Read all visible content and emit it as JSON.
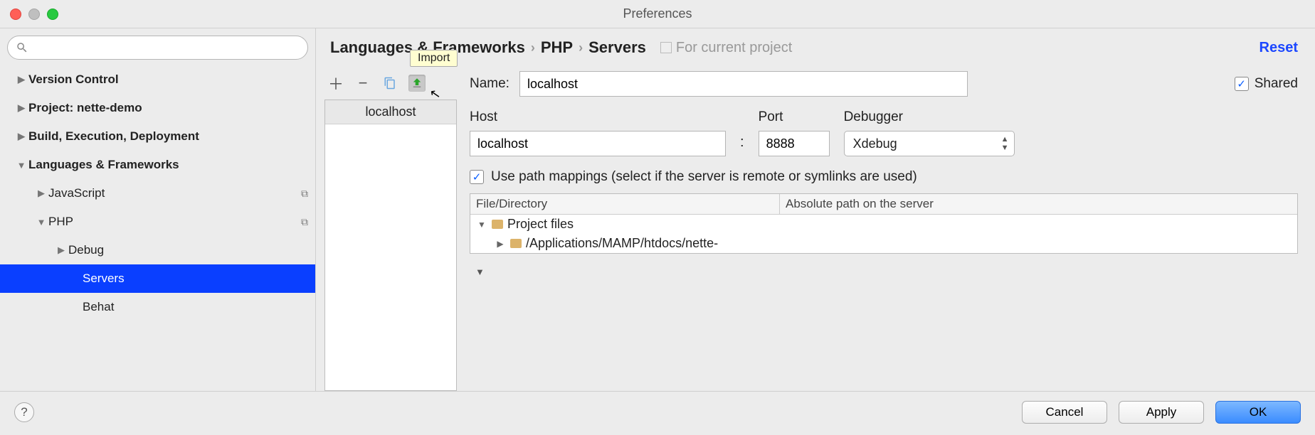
{
  "window": {
    "title": "Preferences"
  },
  "sidebar": {
    "search_placeholder": "",
    "items": [
      {
        "label": "Version Control",
        "bold": true,
        "arrow": "right",
        "indent": 0
      },
      {
        "label": "Project: nette-demo",
        "bold": true,
        "arrow": "right",
        "indent": 0
      },
      {
        "label": "Build, Execution, Deployment",
        "bold": true,
        "arrow": "right",
        "indent": 0
      },
      {
        "label": "Languages & Frameworks",
        "bold": true,
        "arrow": "down",
        "indent": 0
      },
      {
        "label": "JavaScript",
        "bold": false,
        "arrow": "right",
        "indent": 1,
        "copy": true
      },
      {
        "label": "PHP",
        "bold": false,
        "arrow": "down",
        "indent": 1,
        "copy": true
      },
      {
        "label": "Debug",
        "bold": false,
        "arrow": "right",
        "indent": 2
      },
      {
        "label": "Servers",
        "bold": false,
        "arrow": "",
        "indent": 3,
        "selected": true
      },
      {
        "label": "Behat",
        "bold": false,
        "arrow": "",
        "indent": 3
      }
    ]
  },
  "breadcrumb": {
    "parts": [
      "Languages & Frameworks",
      "PHP",
      "Servers"
    ],
    "scope": "For current project",
    "reset": "Reset"
  },
  "toolbar": {
    "tooltip": "Import"
  },
  "servers": {
    "list": [
      "localhost"
    ]
  },
  "form": {
    "name_label": "Name:",
    "name_value": "localhost",
    "shared_label": "Shared",
    "shared_checked": true,
    "host_label": "Host",
    "host_value": "localhost",
    "colon": ":",
    "port_label": "Port",
    "port_value": "8888",
    "debugger_label": "Debugger",
    "debugger_value": "Xdebug",
    "mappings_checked": true,
    "mappings_label": "Use path mappings (select if the server is remote or symlinks are used)"
  },
  "mapping": {
    "col1": "File/Directory",
    "col2": "Absolute path on the server",
    "root": "Project files",
    "path": "/Applications/MAMP/htdocs/nette-"
  },
  "buttons": {
    "cancel": "Cancel",
    "apply": "Apply",
    "ok": "OK"
  }
}
